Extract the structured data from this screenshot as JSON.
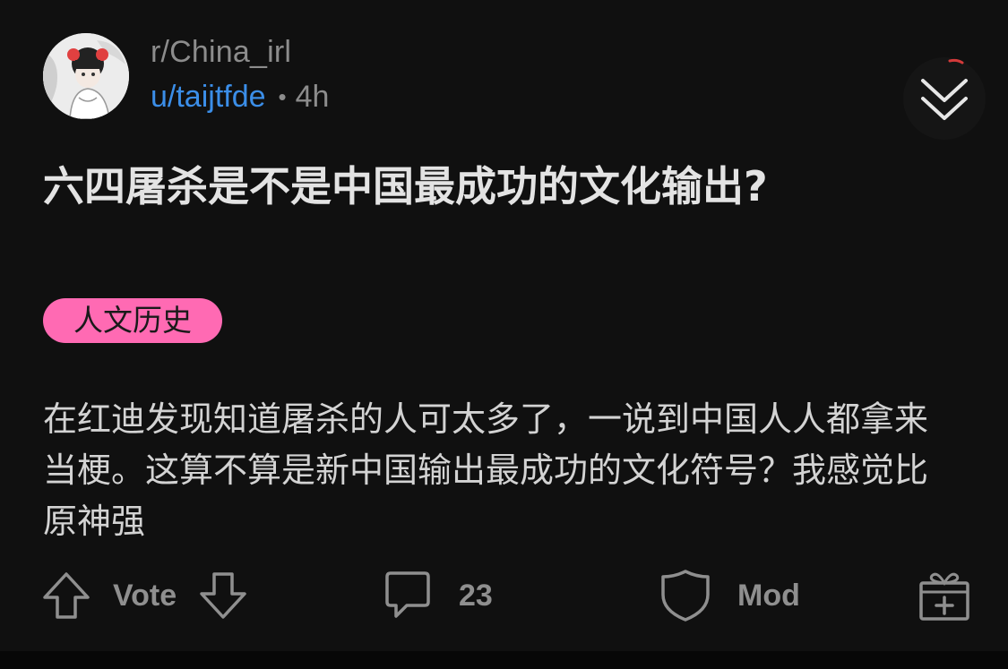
{
  "header": {
    "subreddit": "r/China_irl",
    "username": "u/taijtfde",
    "separator": "•",
    "age": "4h"
  },
  "post": {
    "title": "六四屠杀是不是中国最成功的文化输出?",
    "flair": "人文历史",
    "body": "在红迪发现知道屠杀的人可太多了，一说到中国人人都拿来当梗。这算不算是新中国输出最成功的文化符号？我感觉比原神强"
  },
  "actions": {
    "vote_label": "Vote",
    "comment_count": "23",
    "mod_label": "Mod"
  },
  "icons": {
    "collapse": "double-chevron-down-icon",
    "upvote": "arrow-up-icon",
    "downvote": "arrow-down-icon",
    "comment": "comment-bubble-icon",
    "mod": "shield-icon",
    "award": "gift-icon"
  },
  "colors": {
    "background": "#101010",
    "username": "#3b8ee8",
    "flair_background": "#ff6ab3",
    "muted_text": "#8c8c8c"
  }
}
